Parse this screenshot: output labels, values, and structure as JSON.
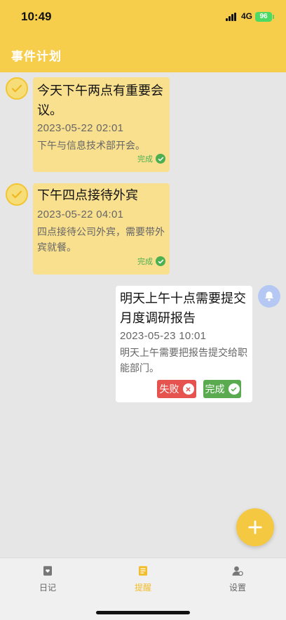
{
  "status_bar": {
    "time": "10:49",
    "network": "4G",
    "battery": "96"
  },
  "header": {
    "title": "事件计划"
  },
  "events": [
    {
      "title": "今天下午两点有重要会议。",
      "date": "2023-05-22 02:01",
      "desc": "下午与信息技术部开会。",
      "status": "完成"
    },
    {
      "title": "下午四点接待外宾",
      "date": "2023-05-22 04:01",
      "desc": "四点接待公司外宾，需要带外宾就餐。",
      "status": "完成"
    },
    {
      "title": "明天上午十点需要提交月度调研报告",
      "date": "2023-05-23 10:01",
      "desc": "明天上午需要把报告提交给职能部门。",
      "fail_label": "失败",
      "done_label": "完成"
    }
  ],
  "tabs": [
    {
      "label": "日记",
      "icon": "diary-icon"
    },
    {
      "label": "提醒",
      "icon": "reminder-icon"
    },
    {
      "label": "设置",
      "icon": "settings-user-icon"
    }
  ],
  "colors": {
    "accent": "#f7cd4c",
    "done": "#5aaa4f",
    "fail": "#e6534e",
    "card_yellow": "#f9e08f"
  }
}
